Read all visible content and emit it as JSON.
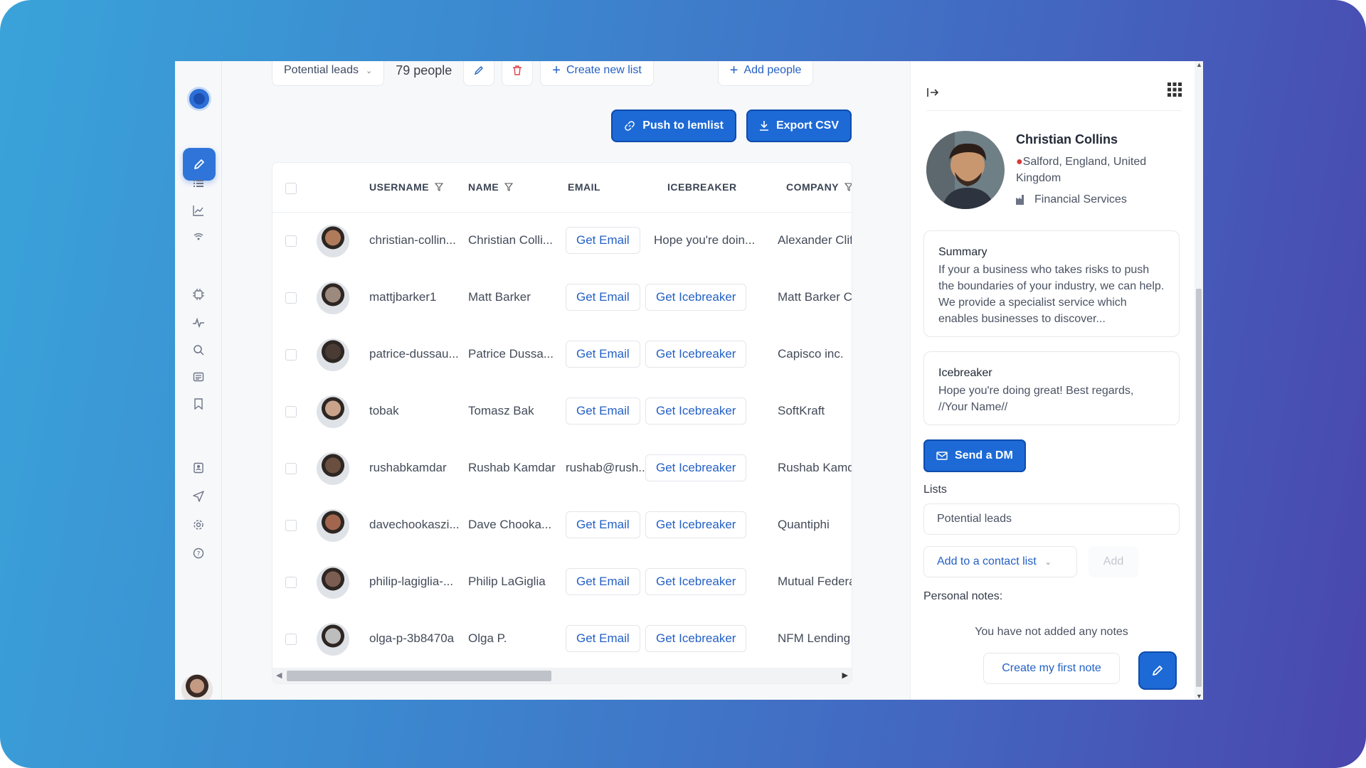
{
  "toolbar": {
    "list_selector": "Potential leads",
    "people_count": "79 people",
    "create_new_list": "Create new list",
    "add_people": "Add people"
  },
  "actions": {
    "push_label": "Push to lemlist",
    "export_label": "Export CSV"
  },
  "table": {
    "headers": {
      "username": "USERNAME",
      "name": "NAME",
      "email": "EMAIL",
      "icebreaker": "ICEBREAKER",
      "company": "COMPANY"
    },
    "rows": [
      {
        "username": "christian-collin...",
        "name": "Christian Colli...",
        "email": "Get Email",
        "email_is_button": true,
        "icebreaker": "Hope you're doin...",
        "icebreaker_is_button": false,
        "company": "Alexander Clif"
      },
      {
        "username": "mattjbarker1",
        "name": "Matt Barker",
        "email": "Get Email",
        "email_is_button": true,
        "icebreaker": "Get Icebreaker",
        "icebreaker_is_button": true,
        "company": "Matt Barker C"
      },
      {
        "username": "patrice-dussau...",
        "name": "Patrice Dussa...",
        "email": "Get Email",
        "email_is_button": true,
        "icebreaker": "Get Icebreaker",
        "icebreaker_is_button": true,
        "company": "Capisco inc."
      },
      {
        "username": "tobak",
        "name": "Tomasz Bak",
        "email": "Get Email",
        "email_is_button": true,
        "icebreaker": "Get Icebreaker",
        "icebreaker_is_button": true,
        "company": "SoftKraft"
      },
      {
        "username": "rushabkamdar",
        "name": "Rushab Kamdar",
        "email": "rushab@rush...",
        "email_is_button": false,
        "icebreaker": "Get Icebreaker",
        "icebreaker_is_button": true,
        "company": "Rushab Kamd"
      },
      {
        "username": "davechookaszi...",
        "name": "Dave Chooka...",
        "email": "Get Email",
        "email_is_button": true,
        "icebreaker": "Get Icebreaker",
        "icebreaker_is_button": true,
        "company": "Quantiphi"
      },
      {
        "username": "philip-lagiglia-...",
        "name": "Philip LaGiglia",
        "email": "Get Email",
        "email_is_button": true,
        "icebreaker": "Get Icebreaker",
        "icebreaker_is_button": true,
        "company": "Mutual Federa"
      },
      {
        "username": "olga-p-3b8470a",
        "name": "Olga P.",
        "email": "Get Email",
        "email_is_button": true,
        "icebreaker": "Get Icebreaker",
        "icebreaker_is_button": true,
        "company": "NFM Lending"
      }
    ]
  },
  "profile": {
    "name": "Christian Collins",
    "location": "Salford, England, United Kingdom",
    "industry": "Financial Services",
    "summary_title": "Summary",
    "summary_text": "If your a business who takes risks to push the boundaries of your industry, we can help. We provide a specialist service which enables businesses to discover...",
    "icebreaker_title": "Icebreaker",
    "icebreaker_text": "Hope you're doing great! Best regards, //Your Name//",
    "send_dm": "Send a DM",
    "lists_label": "Lists",
    "list_value": "Potential leads",
    "add_to_list": "Add to a contact list",
    "add_button": "Add",
    "notes_label": "Personal notes:",
    "notes_empty": "You have not added any notes",
    "create_note": "Create my first note"
  },
  "colors": {
    "primary": "#1d6ad6",
    "link": "#2360c6",
    "background_gradient_start": "#3aa3d9",
    "background_gradient_end": "#4a46ad"
  }
}
